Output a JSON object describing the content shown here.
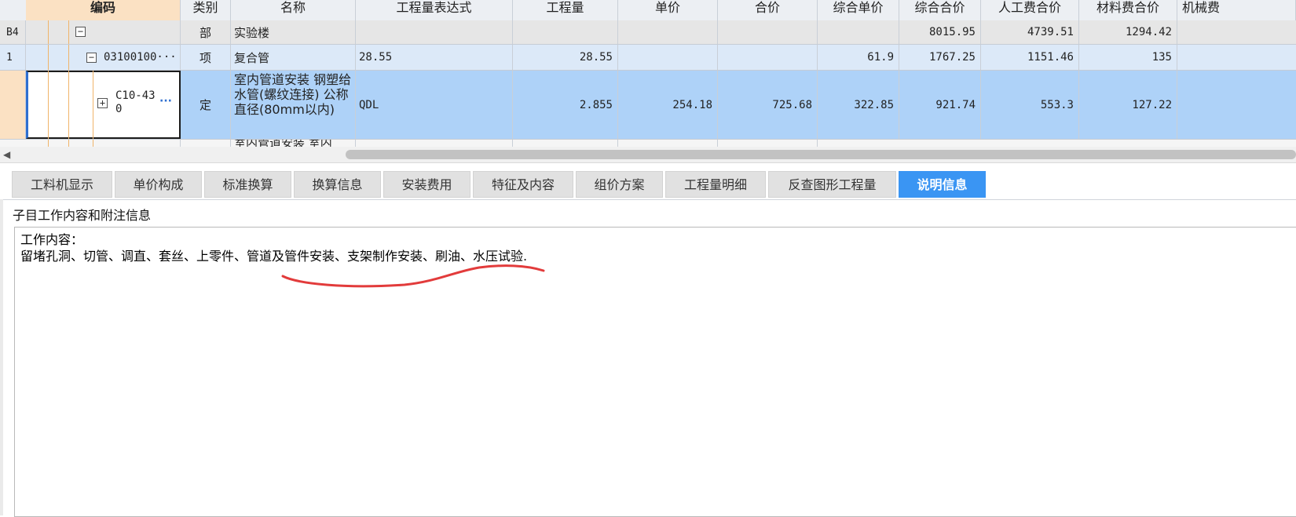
{
  "grid": {
    "headers": [
      "编码",
      "类别",
      "名称",
      "工程量表达式",
      "工程量",
      "单价",
      "合价",
      "综合单价",
      "综合合价",
      "人工费合价",
      "材料费合价",
      "机械费"
    ],
    "rows": [
      {
        "row_no": "B4",
        "code": "",
        "type": "部",
        "name": "实验楼",
        "expr": "",
        "qty": "",
        "price": "",
        "total": "",
        "comp_price": "",
        "comp_total": "8015.95",
        "labor": "4739.51",
        "material": "1294.42",
        "machine": ""
      },
      {
        "row_no": "1",
        "code": "03100100···",
        "type": "项",
        "name": "复合管",
        "expr": "28.55",
        "qty": "28.55",
        "price": "",
        "total": "",
        "comp_price": "61.9",
        "comp_total": "1767.25",
        "labor": "1151.46",
        "material": "135",
        "machine": ""
      },
      {
        "row_no": "",
        "code_line1": "C10-43",
        "code_line2": "0",
        "code_more": "···",
        "type": "定",
        "name": "室内管道安装 钢塑给水管(螺纹连接) 公称直径(80mm以内)",
        "expr": "QDL",
        "qty": "2.855",
        "price": "254.18",
        "total": "725.68",
        "comp_price": "322.85",
        "comp_total": "921.74",
        "labor": "553.3",
        "material": "127.22",
        "machine": ""
      },
      {
        "row_no": "",
        "name_partial": "室内管道安装 室内"
      }
    ]
  },
  "tabs": [
    {
      "label": "工料机显示"
    },
    {
      "label": "单价构成"
    },
    {
      "label": "标准换算"
    },
    {
      "label": "换算信息"
    },
    {
      "label": "安装费用"
    },
    {
      "label": "特征及内容"
    },
    {
      "label": "组价方案"
    },
    {
      "label": "工程量明细"
    },
    {
      "label": "反查图形工程量"
    },
    {
      "label": "说明信息",
      "active": true
    }
  ],
  "info": {
    "title": "子目工作内容和附注信息",
    "line1": "工作内容：",
    "line2": "留堵孔洞、切管、调直、套丝、上零件、管道及管件安装、支架制作安装、刷油、水压试验."
  },
  "colors": {
    "accent": "#3a95f3",
    "selected_row": "#aed2f8",
    "header_active": "#fbe1c3",
    "annotation": "#e23b3b"
  }
}
